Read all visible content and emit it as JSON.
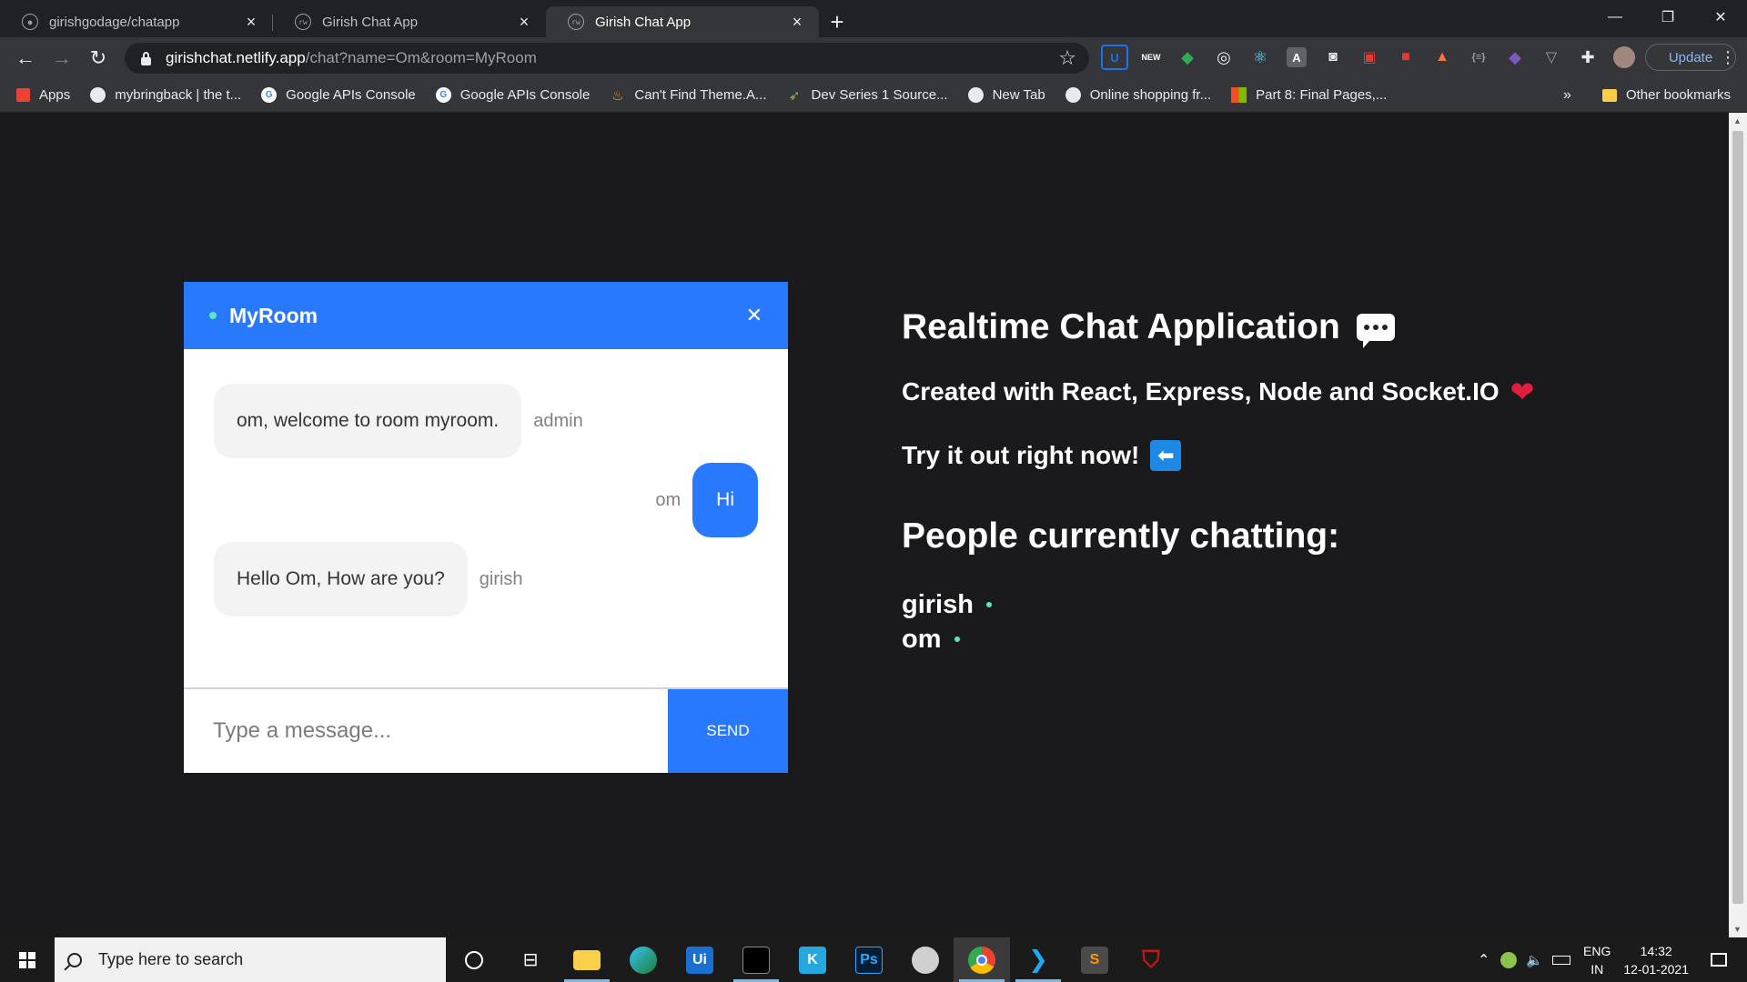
{
  "browser": {
    "tabs": [
      {
        "title": "girishgodage/chatapp",
        "icon": "github-icon"
      },
      {
        "title": "Girish Chat App",
        "icon": "site-icon"
      },
      {
        "title": "Girish Chat App",
        "icon": "site-icon",
        "active": true
      }
    ],
    "url_host": "girishchat.netlify.app",
    "url_path": "/chat?name=Om&room=MyRoom",
    "update_label": "Update",
    "bookmarks": [
      {
        "label": "Apps",
        "icon": "apps-grid-icon"
      },
      {
        "label": "mybringback | the t...",
        "icon": "globe-icon"
      },
      {
        "label": "Google APIs Console",
        "icon": "google-icon"
      },
      {
        "label": "Google APIs Console",
        "icon": "google-icon"
      },
      {
        "label": "Can't Find Theme.A...",
        "icon": "java-icon"
      },
      {
        "label": "Dev Series 1 Source...",
        "icon": "rocket-icon"
      },
      {
        "label": "New Tab",
        "icon": "globe-icon"
      },
      {
        "label": "Online shopping fr...",
        "icon": "globe-icon"
      },
      {
        "label": "Part 8: Final Pages,...",
        "icon": "windows-icon"
      }
    ],
    "other_bookmarks": "Other bookmarks",
    "overflow": "»"
  },
  "chat": {
    "room": "MyRoom",
    "close_label": "✕",
    "messages": [
      {
        "text": "om, welcome to room myroom.",
        "sender": "admin",
        "own": false
      },
      {
        "text": "Hi",
        "sender": "om",
        "own": true
      },
      {
        "text": "Hello Om, How are you?",
        "sender": "girish",
        "own": false
      }
    ],
    "input_placeholder": "Type a message...",
    "send_label": "SEND"
  },
  "info": {
    "title": "Realtime Chat Application",
    "subtitle": "Created with React, Express, Node and Socket.IO",
    "cta": "Try it out right now!",
    "people_heading": "People currently chatting:",
    "people": [
      "girish",
      "om"
    ]
  },
  "taskbar": {
    "search_placeholder": "Type here to search",
    "lang_top": "ENG",
    "lang_bottom": "IN",
    "time": "14:32",
    "date": "12-01-2021"
  },
  "colors": {
    "accent": "#2979ff",
    "online": "#5ee7b4",
    "background": "#1a1a1d"
  }
}
